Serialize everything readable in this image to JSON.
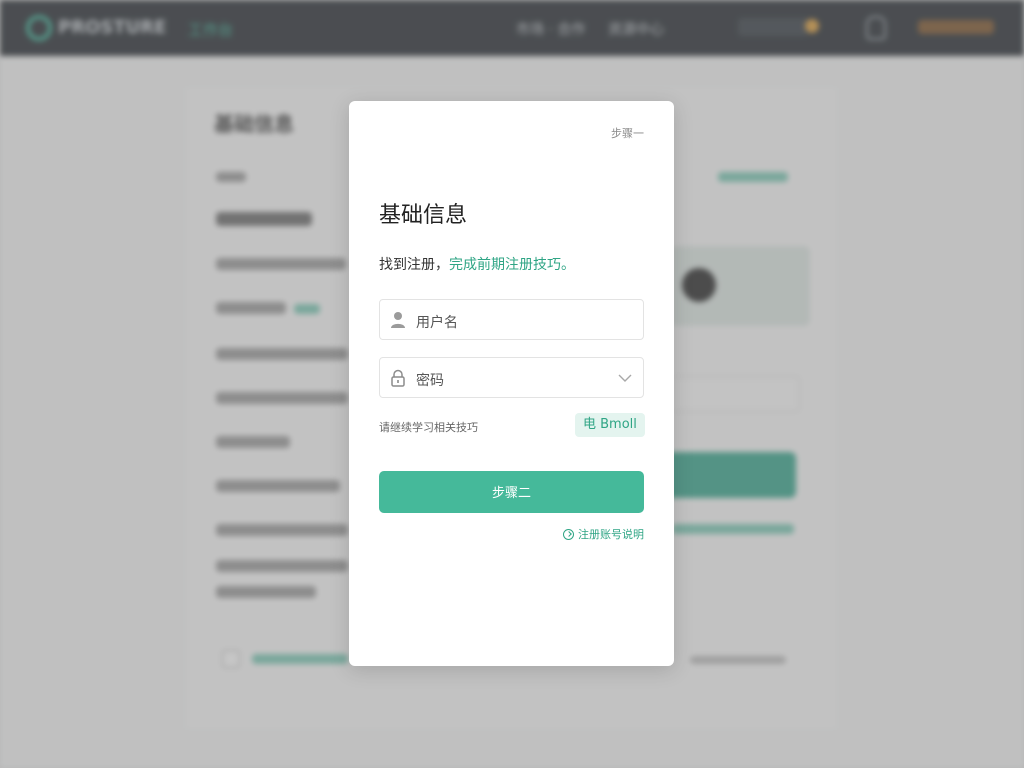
{
  "background": {
    "brand": "PROSTURE",
    "nav_active": "工作台",
    "nav_items": [
      "市场 · 合作",
      "资源中心"
    ],
    "page_title": "基础信息"
  },
  "modal": {
    "step_label": "步骤一",
    "title": "基础信息",
    "hint_text": "找到注册，",
    "hint_link": "完成前期注册技巧。",
    "username_placeholder": "用户名",
    "password_placeholder": "密码",
    "aux_label": "请继续学习相关技巧",
    "aux_chip": "电 Bmoll",
    "primary_button": "步骤二",
    "footer_link": "注册账号说明"
  },
  "colors": {
    "accent": "#45b99a",
    "accent_text": "#2fa585",
    "topbar": "#2b3036"
  }
}
